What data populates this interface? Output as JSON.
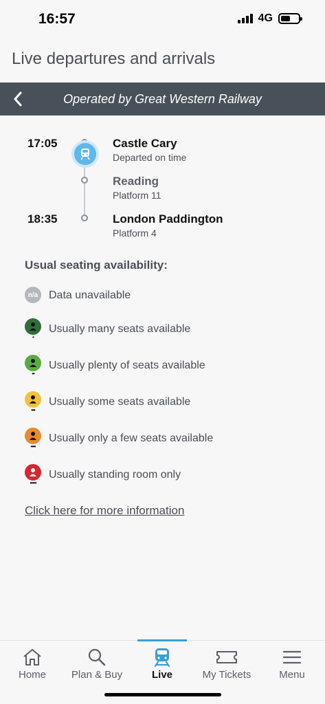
{
  "status": {
    "time": "16:57",
    "network": "4G"
  },
  "page": {
    "title": "Live departures and arrivals"
  },
  "subheader": {
    "operator": "Operated by Great Western Railway"
  },
  "journey": {
    "stops": [
      {
        "time": "17:05",
        "name": "Castle Cary",
        "detail": "Departed on time"
      },
      {
        "time": "",
        "name": "Reading",
        "detail": "Platform 11"
      },
      {
        "time": "18:35",
        "name": "London Paddington",
        "detail": "Platform 4"
      }
    ]
  },
  "seating": {
    "title": "Usual seating availability:",
    "na_badge": "n/a",
    "items": [
      {
        "label": "Data unavailable",
        "color": "#b5b7ba",
        "dots": 0
      },
      {
        "label": "Usually many seats available",
        "color": "#2f6f3a",
        "dots": 1
      },
      {
        "label": "Usually plenty of seats available",
        "color": "#5aac3f",
        "dots": 2
      },
      {
        "label": "Usually some seats available",
        "color": "#f2c23b",
        "dots": 3
      },
      {
        "label": "Usually only a few seats available",
        "color": "#ea8a2c",
        "dots": 4
      },
      {
        "label": "Usually standing room only",
        "color": "#d8262d",
        "dots": 5
      }
    ],
    "link": "Click here for more information"
  },
  "nav": {
    "items": [
      {
        "label": "Home",
        "icon": "home-icon"
      },
      {
        "label": "Plan & Buy",
        "icon": "search-icon"
      },
      {
        "label": "Live",
        "icon": "train-icon",
        "active": true
      },
      {
        "label": "My Tickets",
        "icon": "ticket-icon"
      },
      {
        "label": "Menu",
        "icon": "menu-icon"
      }
    ]
  },
  "colors": {
    "header_bg": "#48515a",
    "accent": "#3a9fd8",
    "train_badge": "#5fb7ea"
  }
}
